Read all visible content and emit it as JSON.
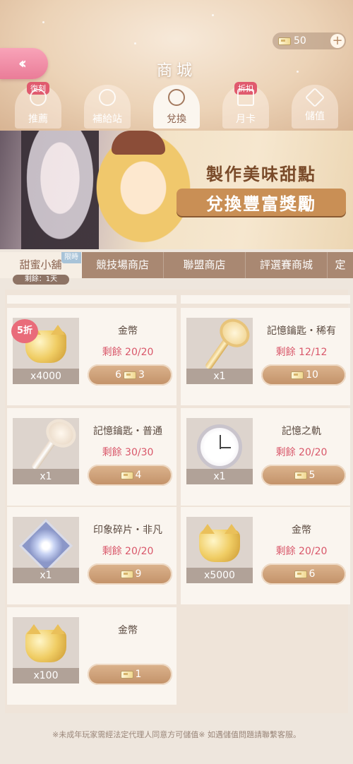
{
  "header": {
    "title": "商城",
    "currency_value": "50",
    "back_icon": "double-chevron-left-icon",
    "add_icon": "plus-icon"
  },
  "tabs": [
    {
      "label": "推薦",
      "badge": "復刻",
      "icon": "thumbs-up-icon"
    },
    {
      "label": "補給站",
      "badge": "",
      "icon": "clock-icon"
    },
    {
      "label": "兌換",
      "badge": "",
      "icon": "exchange-icon",
      "active": true
    },
    {
      "label": "月卡",
      "badge": "折扣",
      "icon": "calendar-icon"
    },
    {
      "label": "儲值",
      "badge": "",
      "icon": "diamond-icon"
    }
  ],
  "banner": {
    "line1": "製作美味甜點",
    "line2": "兌換豐富獎勵"
  },
  "shop_tabs": [
    {
      "label": "甜蜜小舖",
      "badge": "限時",
      "active": true
    },
    {
      "label": "競技場商店"
    },
    {
      "label": "聯盟商店"
    },
    {
      "label": "評選賽商城"
    },
    {
      "label": "定"
    }
  ],
  "remaining": "剩餘：1天",
  "items": [
    {
      "name": "金幣",
      "stock": "剩餘 20/20",
      "qty": "x4000",
      "price_prefix": "6",
      "price": "3",
      "discount": "5折",
      "image": "gold-coin"
    },
    {
      "name": "記憶鑰匙・稀有",
      "stock": "剩餘 12/12",
      "qty": "x1",
      "price_prefix": "",
      "price": "10",
      "image": "gold-key"
    },
    {
      "name": "記憶鑰匙・普通",
      "stock": "剩餘 30/30",
      "qty": "x1",
      "price_prefix": "",
      "price": "4",
      "image": "silver-key"
    },
    {
      "name": "記憶之軌",
      "stock": "剩餘 20/20",
      "qty": "x1",
      "price_prefix": "",
      "price": "5",
      "image": "clock"
    },
    {
      "name": "印象碎片・非凡",
      "stock": "剩餘 20/20",
      "qty": "x1",
      "price_prefix": "",
      "price": "9",
      "image": "shard"
    },
    {
      "name": "金幣",
      "stock": "剩餘 20/20",
      "qty": "x5000",
      "price_prefix": "",
      "price": "6",
      "image": "gold-coin"
    },
    {
      "name": "金幣",
      "stock": "",
      "qty": "x100",
      "price_prefix": "",
      "price": "1",
      "image": "gold-coin"
    }
  ],
  "footer": "※未成年玩家需經法定代理人同意方可儲值※ 如遇儲值問題請聯繫客服。"
}
